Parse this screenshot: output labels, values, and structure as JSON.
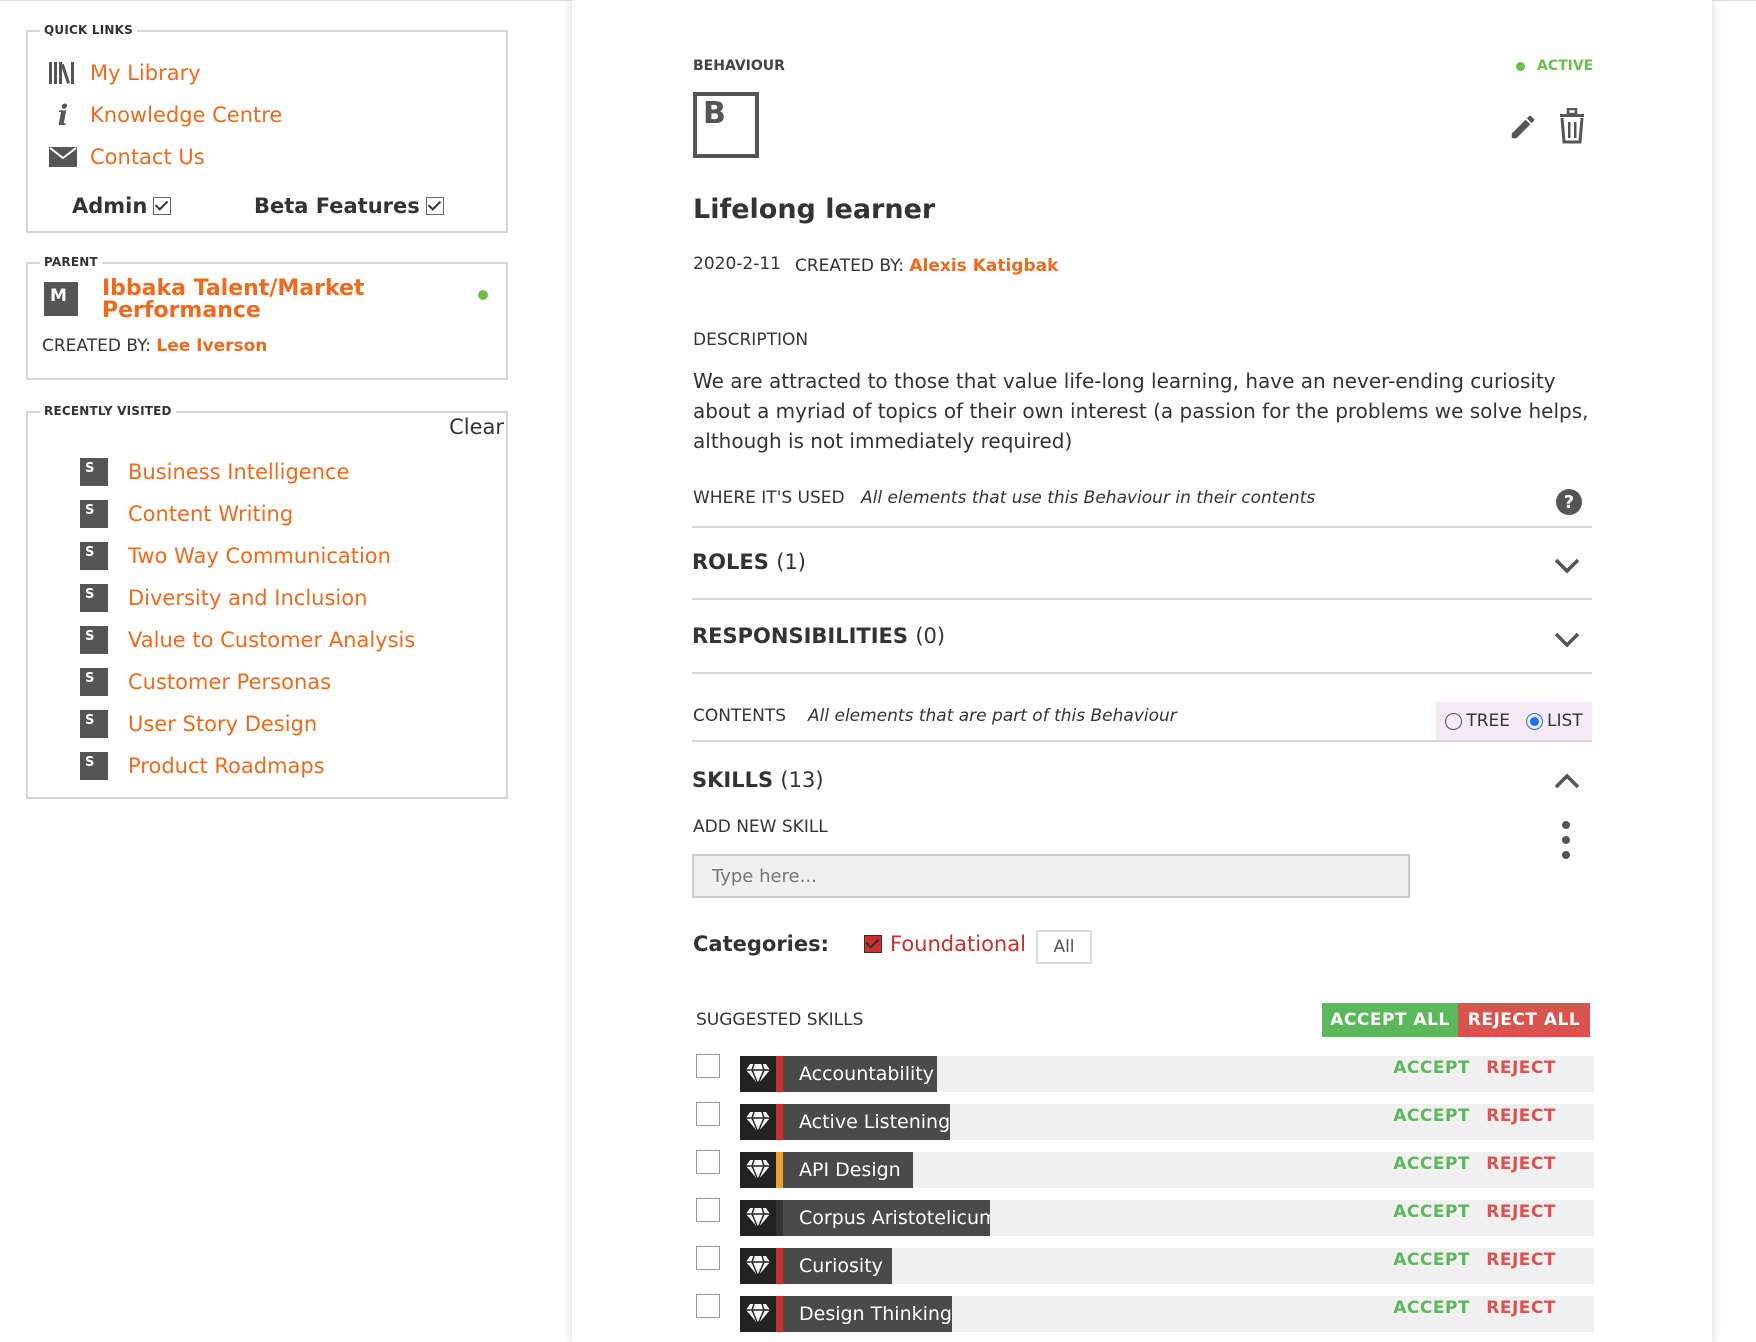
{
  "quick_links": {
    "legend": "QUICK LINKS",
    "items": [
      {
        "label": "My Library",
        "icon": "library-icon"
      },
      {
        "label": "Knowledge Centre",
        "icon": "info-icon"
      },
      {
        "label": "Contact Us",
        "icon": "mail-icon"
      }
    ],
    "admin_label": "Admin",
    "admin_checked": true,
    "beta_label": "Beta Features",
    "beta_checked": true
  },
  "parent": {
    "legend": "PARENT",
    "badge": "M",
    "title": "Ibbaka Talent/Market Performance",
    "created_by_label": "CREATED BY:",
    "created_by": "Lee Iverson",
    "status_color": "#6cc04a"
  },
  "recently_visited": {
    "legend": "RECENTLY VISITED",
    "clear_label": "Clear",
    "badge": "S",
    "items": [
      "Business Intelligence",
      "Content Writing",
      "Two Way Communication",
      "Diversity and Inclusion",
      "Value to Customer Analysis",
      "Customer Personas",
      "User Story Design",
      "Product Roadmaps"
    ]
  },
  "detail": {
    "type_label": "BEHAVIOUR",
    "status": "ACTIVE",
    "status_color": "#6cc04a",
    "type_badge": "B",
    "title": "Lifelong learner",
    "date": "2020-2-11",
    "created_by_label": "CREATED BY:",
    "created_by": "Alexis Katigbak",
    "description_label": "DESCRIPTION",
    "description": "We are attracted to those that value life-long learning, have an never-ending curiosity about a myriad of topics of their own interest (a passion for the problems we solve helps, although is not immediately required)",
    "where_used_label": "WHERE IT'S USED",
    "where_used_text": "All elements that use this Behaviour in their contents",
    "roles_label": "ROLES",
    "roles_count": "(1)",
    "responsibilities_label": "RESPONSIBILITIES",
    "responsibilities_count": "(0)",
    "contents_label": "CONTENTS",
    "contents_text": "All elements that are part of this Behaviour",
    "view_tree_label": "TREE",
    "view_list_label": "LIST",
    "view_selected": "LIST",
    "skills_label": "SKILLS",
    "skills_count": "(13)",
    "add_skill_label": "ADD NEW SKILL",
    "add_skill_placeholder": "Type here...",
    "categories_label": "Categories:",
    "category_foundational": "Foundational",
    "category_foundational_checked": true,
    "category_all": "All",
    "suggested_label": "SUGGESTED SKILLS",
    "accept_all_label": "ACCEPT ALL",
    "reject_all_label": "REJECT ALL",
    "accept_label": "ACCEPT",
    "reject_label": "REJECT",
    "accent_colors": {
      "accept": "#5cb85c",
      "reject": "#d9534f",
      "link": "#ee6a1c"
    },
    "skills": [
      {
        "name": "Accountability",
        "bar_color": "#c9302c"
      },
      {
        "name": "Active Listening",
        "bar_color": "#c9302c"
      },
      {
        "name": "API Design",
        "bar_color": "#f0a030"
      },
      {
        "name": "Corpus Aristotelicum",
        "bar_color": "#333333"
      },
      {
        "name": "Curiosity",
        "bar_color": "#c9302c"
      },
      {
        "name": "Design Thinking",
        "bar_color": "#c9302c"
      }
    ]
  }
}
